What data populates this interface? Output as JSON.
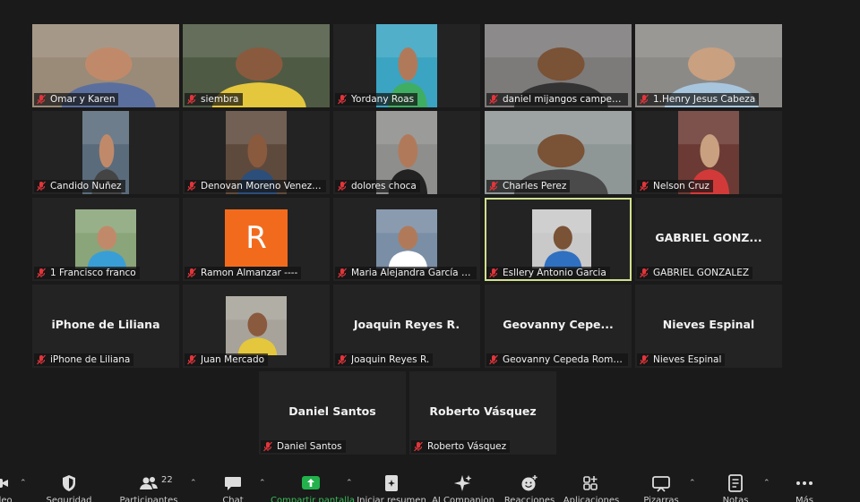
{
  "meeting": {
    "participants": [
      {
        "name": "Omar y Karen",
        "type": "video",
        "bg": "#9a8a78"
      },
      {
        "name": "siembra",
        "type": "video",
        "bg": "#4f5a44"
      },
      {
        "name": "Yordany Roas",
        "type": "video",
        "bg": "#3aa4c2"
      },
      {
        "name": "daniel mijangos campeche",
        "type": "video",
        "bg": "#7d7a7a"
      },
      {
        "name": "1.Henry Jesus Cabeza",
        "type": "video",
        "bg": "#8c8a87"
      },
      {
        "name": "Candido Nuñez",
        "type": "video",
        "bg": "#5a6b7c"
      },
      {
        "name": "Denovan Moreno Venezuela",
        "type": "video",
        "bg": "#5e4a3c"
      },
      {
        "name": "dolores choca",
        "type": "video",
        "bg": "#8e8e8c"
      },
      {
        "name": "Charles Perez",
        "type": "video",
        "bg": "#8f9796"
      },
      {
        "name": "Nelson  Cruz",
        "type": "video",
        "bg": "#6b3a34"
      },
      {
        "name": "1 Francisco franco",
        "type": "video",
        "bg": "#8aa579"
      },
      {
        "name": "Ramon Almanzar ----",
        "type": "initial",
        "initial": "R"
      },
      {
        "name": "Maria Alejandra García Ro...",
        "type": "video",
        "bg": "#7a8ea6"
      },
      {
        "name": "Esllery Antonio Garcia",
        "type": "video",
        "bg": "#c9c9c9",
        "active": true
      },
      {
        "name": "GABRIEL GONZALEZ",
        "type": "name",
        "big": "GABRIEL  GONZ..."
      },
      {
        "name": "iPhone de Liliana",
        "type": "name",
        "big": "iPhone de Liliana"
      },
      {
        "name": "Juan Mercado",
        "type": "video",
        "bg": "#a7a39a"
      },
      {
        "name": "Joaquin Reyes R.",
        "type": "name",
        "big": "Joaquin Reyes R."
      },
      {
        "name": "Geovanny Cepeda Romero",
        "type": "name",
        "big": "Geovanny  Cepe..."
      },
      {
        "name": "Nieves Espinal",
        "type": "name",
        "big": "Nieves Espinal"
      },
      {
        "name": "Daniel Santos",
        "type": "name",
        "big": "Daniel Santos"
      },
      {
        "name": "Roberto Vásquez",
        "type": "name",
        "big": "Roberto Vásquez"
      }
    ]
  },
  "toolbar": {
    "items": [
      {
        "label": "video",
        "icon": "video-camera-icon"
      },
      {
        "label": "Seguridad",
        "icon": "shield-icon"
      },
      {
        "label": "Participantes",
        "icon": "participants-icon",
        "count": "22"
      },
      {
        "label": "Chat",
        "icon": "chat-icon"
      },
      {
        "label": "Compartir pantalla",
        "icon": "share-screen-icon",
        "green": true
      },
      {
        "label": "Iniciar resumen",
        "icon": "summary-icon"
      },
      {
        "label": "AI Companion",
        "icon": "ai-companion-icon"
      },
      {
        "label": "Reacciones",
        "icon": "reactions-icon"
      },
      {
        "label": "Aplicaciones",
        "icon": "apps-icon"
      },
      {
        "label": "Pizarras",
        "icon": "whiteboard-icon"
      },
      {
        "label": "Notas",
        "icon": "notes-icon"
      },
      {
        "label": "Más",
        "icon": "more-icon"
      }
    ]
  },
  "colors": {
    "background": "#1a1a1a",
    "tile": "#232323",
    "active_border": "#cfe08f",
    "mute_red": "#e2353b",
    "share_green": "#3bbd5a"
  }
}
